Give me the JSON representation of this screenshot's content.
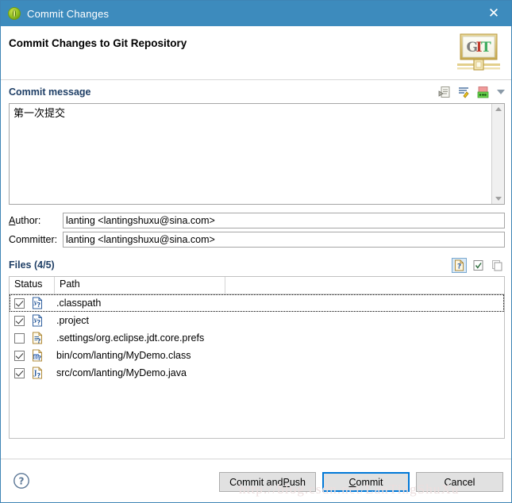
{
  "window": {
    "title": "Commit Changes",
    "icon": "git-commit-circle-icon",
    "close_label": "✕"
  },
  "header": {
    "title": "Commit Changes to Git Repository",
    "logo_text": {
      "g": "G",
      "i": "I",
      "t": "T"
    }
  },
  "commit_message": {
    "section_title": "Commit message",
    "value": "第一次提交",
    "placeholder": "",
    "toolbar": [
      {
        "name": "amend-previous-commit-icon",
        "title": "Amend Previous Commit"
      },
      {
        "name": "sign-off-icon",
        "title": "Add Signed-off-by"
      },
      {
        "name": "add-change-id-icon",
        "title": "Add Change-Id"
      },
      {
        "name": "chevron-down-icon",
        "title": "More"
      }
    ]
  },
  "author": {
    "label": "Author:",
    "mnemonic": "A",
    "label_rest": "uthor:",
    "value": "lanting <lantingshuxu@sina.com>"
  },
  "committer": {
    "label": "Committer:",
    "value": "lanting <lantingshuxu@sina.com>"
  },
  "files": {
    "section_title": "Files",
    "count_label": "(4/5)",
    "toolbar": [
      {
        "name": "show-untracked-files-icon",
        "title": "Show untracked files",
        "active": true
      },
      {
        "name": "select-all-icon",
        "title": "Select all",
        "active": false
      },
      {
        "name": "deselect-all-icon",
        "title": "Deselect all",
        "active": false
      }
    ],
    "columns": [
      "Status",
      "Path"
    ],
    "rows": [
      {
        "checked": true,
        "icon": "xml-file-untracked-icon",
        "path": ".classpath",
        "focused": true
      },
      {
        "checked": true,
        "icon": "xml-file-untracked-icon",
        "path": ".project",
        "focused": false
      },
      {
        "checked": false,
        "icon": "prefs-file-untracked-icon",
        "path": ".settings/org.eclipse.jdt.core.prefs",
        "focused": false
      },
      {
        "checked": true,
        "icon": "class-file-untracked-icon",
        "path": "bin/com/lanting/MyDemo.class",
        "focused": false
      },
      {
        "checked": true,
        "icon": "java-file-untracked-icon",
        "path": "src/com/lanting/MyDemo.java",
        "focused": false
      }
    ]
  },
  "footer": {
    "help_icon": "help-question-icon",
    "buttons": [
      {
        "name": "commit-and-push-button",
        "text_before": "Commit and ",
        "mnemonic": "P",
        "text_after": "ush",
        "default": false
      },
      {
        "name": "commit-button",
        "text_before": "",
        "mnemonic": "C",
        "text_after": "ommit",
        "default": true
      },
      {
        "name": "cancel-button",
        "text_before": "Cancel",
        "mnemonic": "",
        "text_after": "",
        "default": false
      }
    ]
  },
  "watermark": {
    "text": "http://blog.csdn.net/LanTingShuXu"
  }
}
